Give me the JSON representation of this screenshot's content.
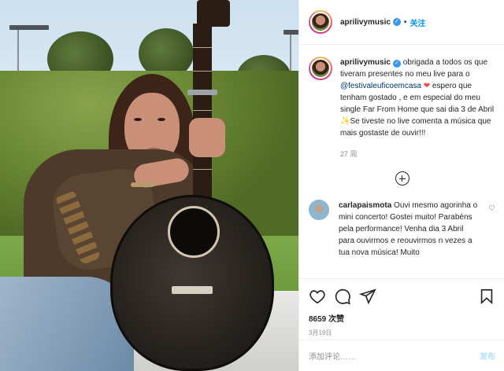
{
  "header": {
    "username": "aprilivymusic",
    "follow_label": "关注",
    "dot": "•"
  },
  "caption": {
    "username": "aprilivymusic",
    "text_1": "obrigada a todos os que tiveram presentes no meu live para o ",
    "mention": "@festivaleuficoemcasa",
    "heart": "❤",
    "text_2": " espero que tenham gostado , e em especial do meu single Far From Home que sai dia 3 de Abril ",
    "sparkle": "✨",
    "text_3": "Se tiveste no live comenta a música que mais gostaste de ouvir!!!",
    "age": "27 周"
  },
  "comments": [
    {
      "username": "carlapaismota",
      "text": "Ouvi mesmo agorinha o mini concerto! Gostei muito! Parabéns pela performance! Venha dia 3 Abril para ouvirmos e reouvirmos n vezes a tua nova música! Muito",
      "like_icon": "♡"
    }
  ],
  "actions": {
    "likes": "8659 次赞",
    "date": "3月19日"
  },
  "add_comment": {
    "placeholder": "添加评论……",
    "post_label": "发布"
  },
  "colors": {
    "accent": "#0095f6",
    "verified": "#3897f0",
    "post_disabled": "#b2dffc"
  }
}
